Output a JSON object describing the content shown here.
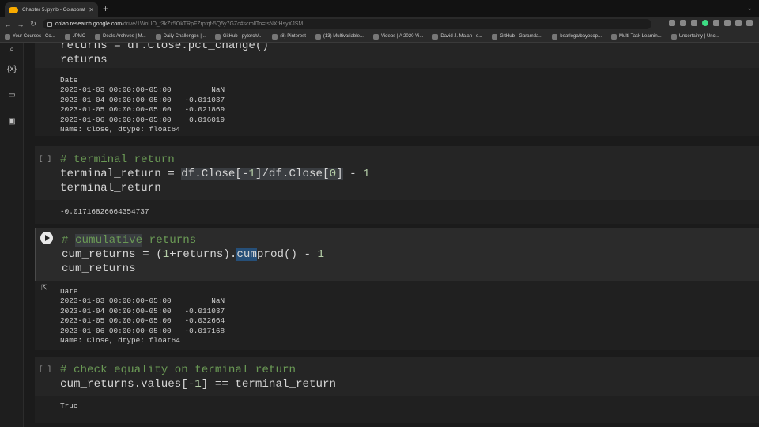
{
  "browser": {
    "tab_title": "Chapter 5.ipynb - Colaboratory",
    "url_host": "colab.research.google.com",
    "url_path": "/drive/1WoUO_f3kZx5OkTRpFZrpfqf-5Q5y7GZc#scrollTo=tsNXfHsyXJSM",
    "bookmarks": [
      "Your Courses | Co...",
      "JPMC",
      "Deals Archives | M...",
      "Daily Challenges |...",
      "GitHub - pytorch/...",
      "(8) Pinterest",
      "(13) Multivariable...",
      "Videos | A 2020 Vi...",
      "David J. Malan | e...",
      "GitHub - Garamda...",
      "bearloga/bayesop...",
      "Multi-Task Learnin...",
      "Uncertainty | Unc..."
    ]
  },
  "cells": {
    "c1_out": "Date\n2023-01-03 00:00:00-05:00         NaN\n2023-01-04 00:00:00-05:00   -0.011037\n2023-01-05 00:00:00-05:00   -0.021869\n2023-01-06 00:00:00-05:00    0.016019\nName: Close, dtype: float64",
    "c2_bracket": "[ ]",
    "c2_comment": "# terminal return",
    "c2_line2a": "terminal_return = ",
    "c2_line2b": "df.Close[-",
    "c2_num1": "1",
    "c2_line2c": "]/df.Close[",
    "c2_num0": "0",
    "c2_line2d": "] - ",
    "c2_num1b": "1",
    "c2_line3": "terminal_return",
    "c2_out": "-0.01716826664354737",
    "c3_comment_pre": "# ",
    "c3_comment_hl": "cumulative",
    "c3_comment_post": " returns",
    "c3_line2a": "cum_returns = (",
    "c3_num1": "1",
    "c3_line2b": "+returns).",
    "c3_hl": "cum",
    "c3_line2c": "prod() - ",
    "c3_num1b": "1",
    "c3_line3": "cum_returns",
    "c3_out": "Date\n2023-01-03 00:00:00-05:00         NaN\n2023-01-04 00:00:00-05:00   -0.011037\n2023-01-05 00:00:00-05:00   -0.032664\n2023-01-06 00:00:00-05:00   -0.017168\nName: Close, dtype: float64",
    "c4_bracket": "[ ]",
    "c4_comment": "# check equality on terminal return",
    "c4_line2a": "cum_returns.values[-",
    "c4_num1": "1",
    "c4_line2b": "] == terminal_return",
    "c4_out": "True"
  }
}
